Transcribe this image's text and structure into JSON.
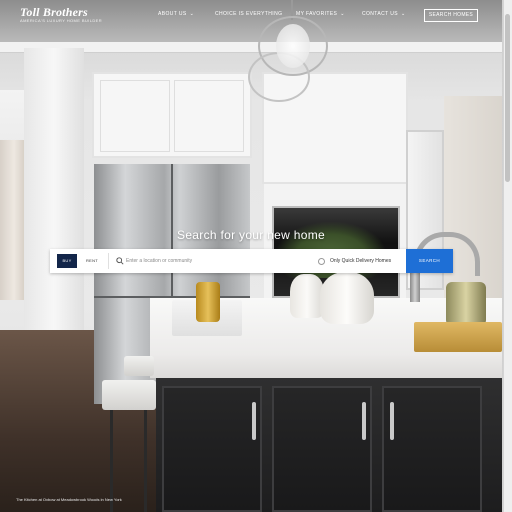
{
  "header": {
    "logo": {
      "name": "Toll Brothers",
      "tagline": "America's Luxury Home Builder"
    },
    "nav": [
      {
        "label": "About Us",
        "has_dropdown": true
      },
      {
        "label": "Choice is Everything",
        "has_dropdown": false
      },
      {
        "label": "My Favorites",
        "has_dropdown": true
      },
      {
        "label": "Contact Us",
        "has_dropdown": true
      }
    ],
    "search_homes_button": "Search Homes"
  },
  "hero": {
    "heading": "Search for your new home",
    "tabs": [
      {
        "label": "Buy",
        "active": true
      },
      {
        "label": "Rent",
        "active": false
      }
    ],
    "location_input": {
      "value": "",
      "placeholder": "Enter a location or community"
    },
    "quick_delivery_label": "Only Quick Delivery Homes",
    "search_button": "Search",
    "search_icon": "search-icon"
  },
  "photo_caption": "The Kitchen at Oxbow at Meadowbrook Woods in New York",
  "colors": {
    "buy_tab_bg": "#13264a",
    "search_button_bg": "#1e6fd6",
    "header_text": "#ffffff"
  }
}
